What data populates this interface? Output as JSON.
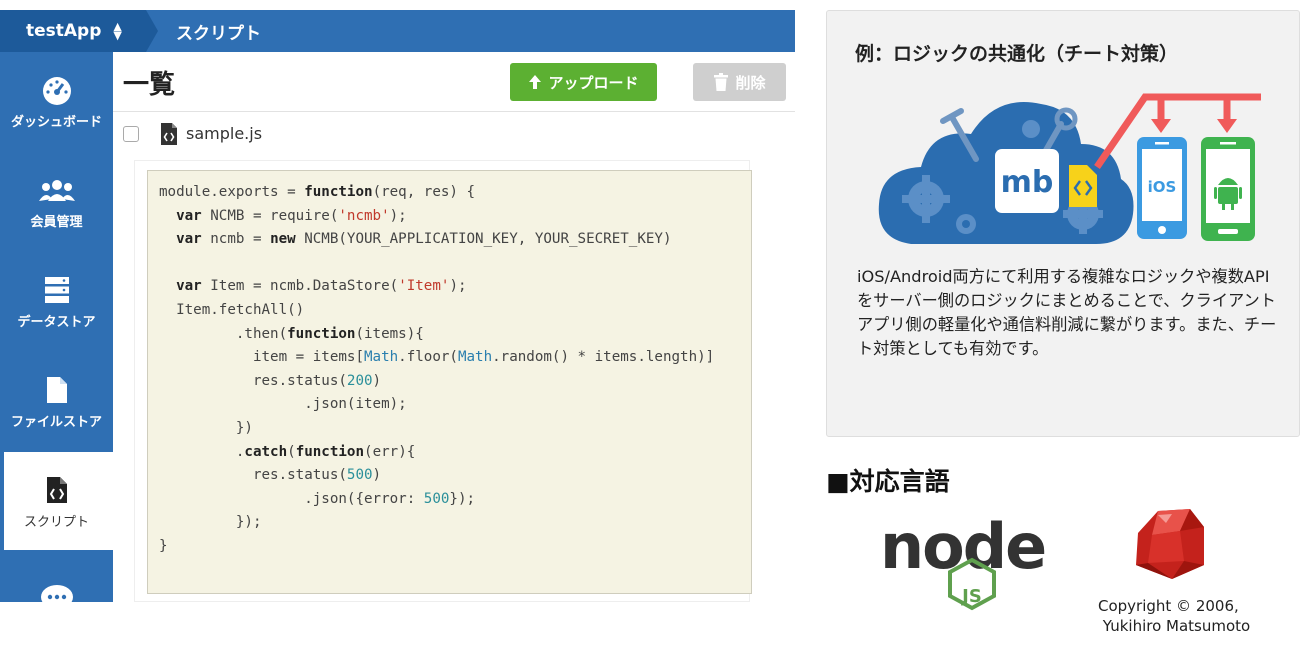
{
  "app": {
    "app_name": "testApp",
    "page_title": "スクリプト",
    "sidebar": [
      {
        "label": "ダッシュボード",
        "icon": "dashboard-icon"
      },
      {
        "label": "会員管理",
        "icon": "users-icon"
      },
      {
        "label": "データストア",
        "icon": "datastore-icon"
      },
      {
        "label": "ファイルストア",
        "icon": "file-icon"
      },
      {
        "label": "スクリプト",
        "icon": "script-file-icon"
      },
      {
        "label": "",
        "icon": "chat-icon"
      }
    ],
    "list_title": "一覧",
    "upload_label": "アップロード",
    "delete_label": "削除",
    "file_name": "sample.js",
    "code_lines": [
      "module.exports = function(req, res) {",
      "  var NCMB = require('ncmb');",
      "  var ncmb = new NCMB(YOUR_APPLICATION_KEY, YOUR_SECRET_KEY)",
      "",
      "  var Item = ncmb.DataStore('Item');",
      "  Item.fetchAll()",
      "         .then(function(items){",
      "           item = items[Math.floor(Math.random() * items.length)]",
      "           res.status(200)",
      "                 .json(item);",
      "         })",
      "         .catch(function(err){",
      "           res.status(500)",
      "                 .json({error: 500});",
      "         });",
      "}"
    ]
  },
  "panel": {
    "title": "例：ロジックの共通化（チート対策）",
    "logo_text": "mb",
    "ios_label": "iOS",
    "description": "iOS/Android両方にて利用する複雑なロジックや複数APIをサーバー側のロジックにまとめることで、クライアントアプリ側の軽量化や通信料削減に繋がります。また、チート対策としても有効です。"
  },
  "languages": {
    "heading": "■対応言語",
    "node_label": "node",
    "node_sub": "JS",
    "copyright": "Copyright © 2006,\n Yukihiro Matsumoto"
  },
  "colors": {
    "sidebar": "#2f6fb3",
    "upload": "#5cb032",
    "cloud": "#2b6db0",
    "arrow": "#f05a5a",
    "node_green": "#5fa04e"
  }
}
